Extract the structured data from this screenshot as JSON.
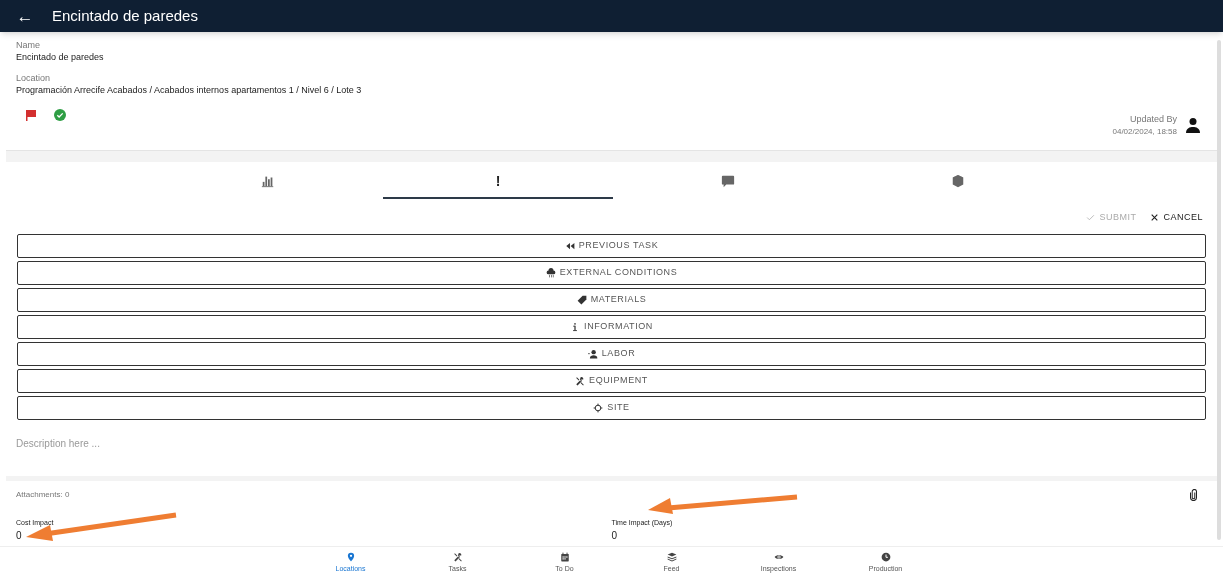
{
  "header": {
    "back_icon": "←",
    "title": "Encintado de paredes"
  },
  "details": {
    "name_label": "Name",
    "name": "Encintado de paredes",
    "location_label": "Location",
    "location": "Programación Arrecife Acabados / Acabados internos apartamentos 1 / Nivel 6 / Lote 3",
    "flagged": true,
    "completed": true,
    "updated_label": "Updated By",
    "updated_at": "04/02/2024, 18:58"
  },
  "tabs": [
    {
      "selected": false
    },
    {
      "label": "!",
      "selected": true
    },
    {
      "selected": false
    },
    {
      "selected": false
    }
  ],
  "actions": [
    {
      "label": "SUBMIT",
      "disabled": true
    },
    {
      "label": "CANCEL",
      "disabled": false
    }
  ],
  "categories": [
    {
      "label": "PREVIOUS TASK"
    },
    {
      "label": "EXTERNAL CONDITIONS"
    },
    {
      "label": "MATERIALS"
    },
    {
      "label": "INFORMATION"
    },
    {
      "label": "LABOR"
    },
    {
      "label": "EQUIPMENT"
    },
    {
      "label": "SITE"
    }
  ],
  "description": {
    "placeholder": "Description here ..."
  },
  "attachments": "Attachments: 0",
  "impacts": [
    {
      "label": "Cost Impact",
      "value": "0"
    },
    {
      "label": "Time Impact (Days)",
      "value": "0"
    }
  ],
  "bottom_nav": [
    {
      "label": "Locations",
      "selected": true
    },
    {
      "label": "Tasks",
      "selected": false
    },
    {
      "label": "To Do",
      "selected": false
    },
    {
      "label": "Feed",
      "selected": false
    },
    {
      "label": "Inspections",
      "selected": false
    },
    {
      "label": "Production",
      "selected": false
    }
  ]
}
